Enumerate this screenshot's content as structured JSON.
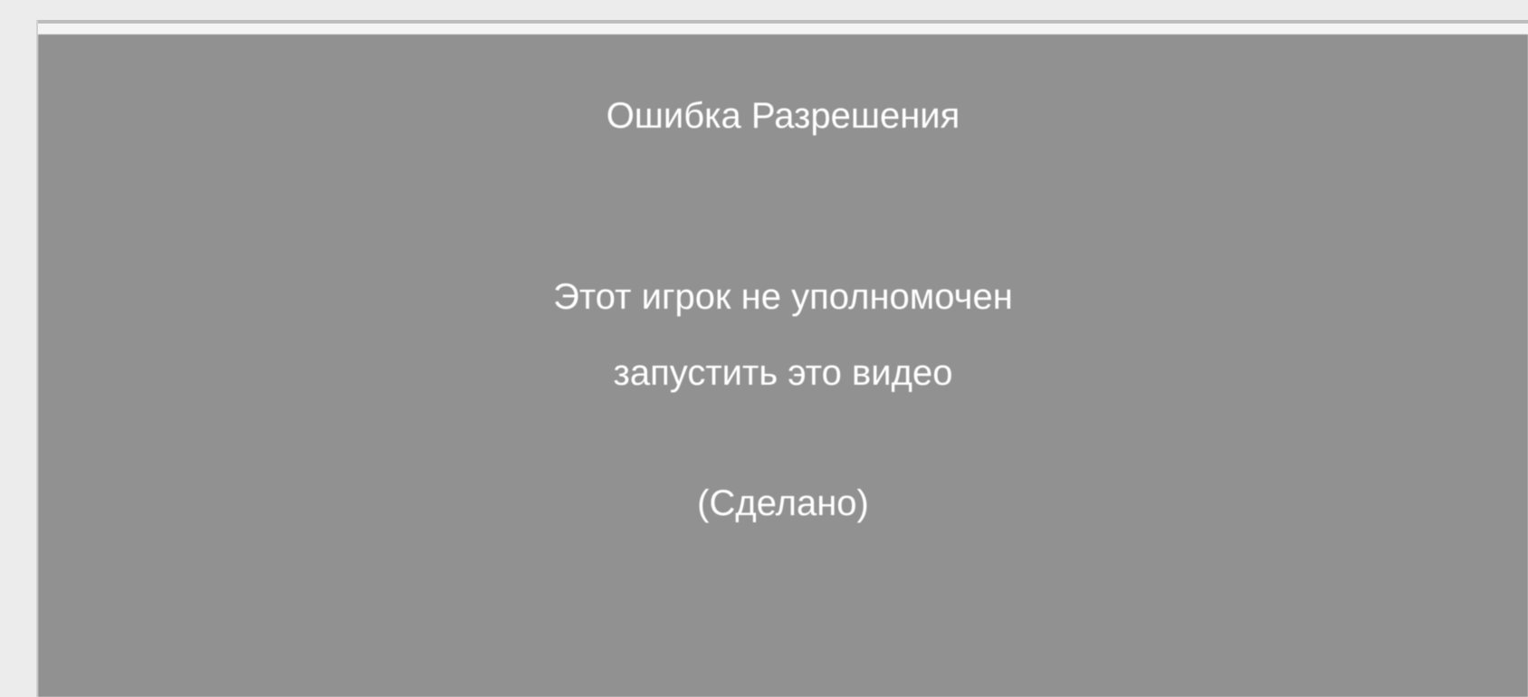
{
  "error": {
    "title": "Ошибка Разрешения",
    "message_line1": "Этот игрок не уполномочен",
    "message_line2": "запустить это видео",
    "done_label": "(Сделано)"
  },
  "colors": {
    "panel_background": "#919191",
    "text": "#ffffff",
    "page_background": "#ececec"
  }
}
